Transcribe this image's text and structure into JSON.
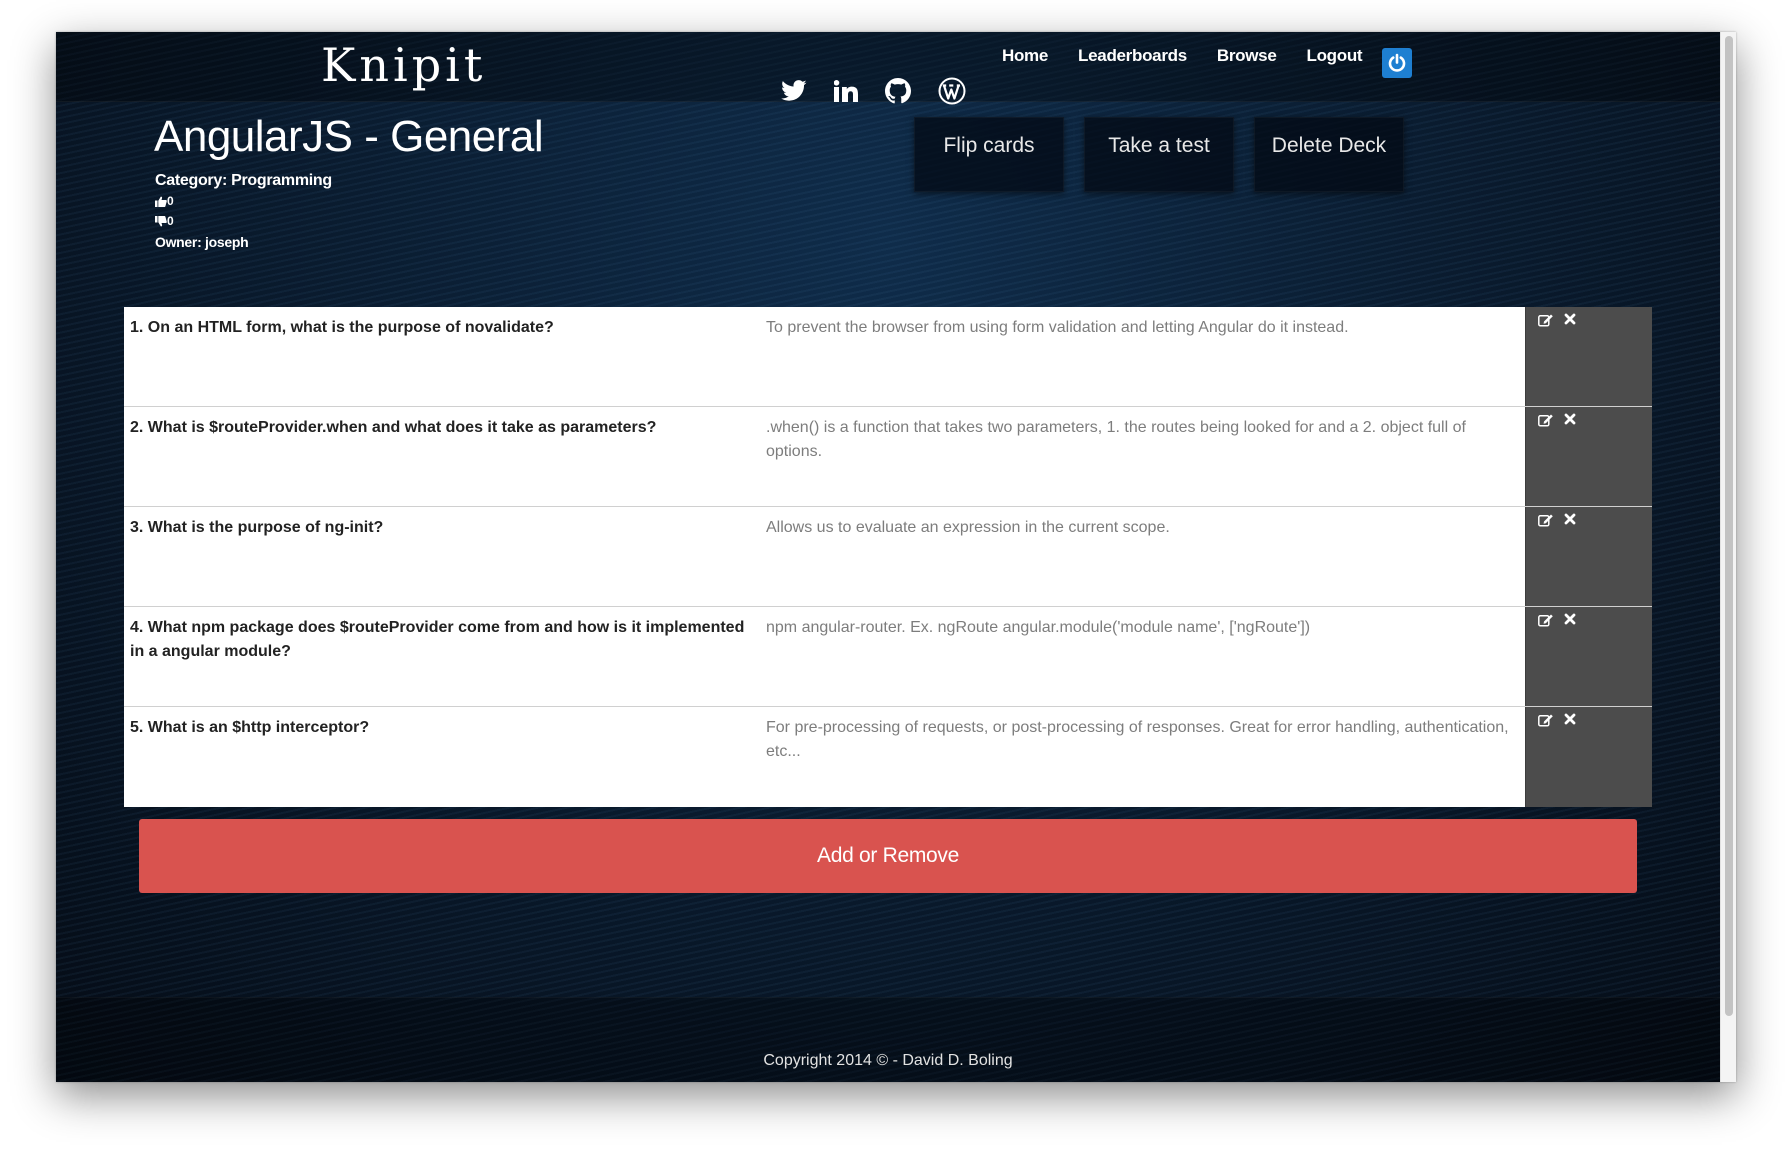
{
  "brand": "Knipit",
  "nav": {
    "home": "Home",
    "leaderboards": "Leaderboards",
    "browse": "Browse",
    "logout": "Logout"
  },
  "deck": {
    "title": "AngularJS - General",
    "category": "Category: Programming",
    "upvotes": "0",
    "downvotes": "0",
    "owner": "Owner: joseph"
  },
  "actions": {
    "flip": "Flip cards",
    "test": "Take a test",
    "delete": "Delete Deck"
  },
  "cards": [
    {
      "question": "1. On an HTML form, what is the purpose of novalidate?",
      "answer": "To prevent the browser from using form validation and letting Angular do it instead."
    },
    {
      "question": "2. What is $routeProvider.when and what does it take as parameters?",
      "answer": ".when() is a function that takes two parameters, 1. the routes being looked for and a 2. object full of options."
    },
    {
      "question": "3. What is the purpose of ng-init?",
      "answer": "Allows us to evaluate an expression in the current scope."
    },
    {
      "question": "4. What npm package does $routeProvider come from and how is it implemented in a angular module?",
      "answer": "npm angular-router. Ex. ngRoute angular.module('module name', ['ngRoute'])"
    },
    {
      "question": "5. What is an $http interceptor?",
      "answer": "For pre-processing of requests, or post-processing of responses. Great for error handling, authentication, etc..."
    }
  ],
  "add_remove_label": "Add or Remove",
  "footer": {
    "copyright": "Copyright 2014 © - David D. Boling",
    "icons": [
      "twitter-icon",
      "linkedin-icon",
      "github-icon",
      "wordpress-icon"
    ]
  },
  "colors": {
    "accent_red": "#d9534f",
    "power_blue": "#1e7fd1",
    "action_cell": "#4c4c4c"
  }
}
